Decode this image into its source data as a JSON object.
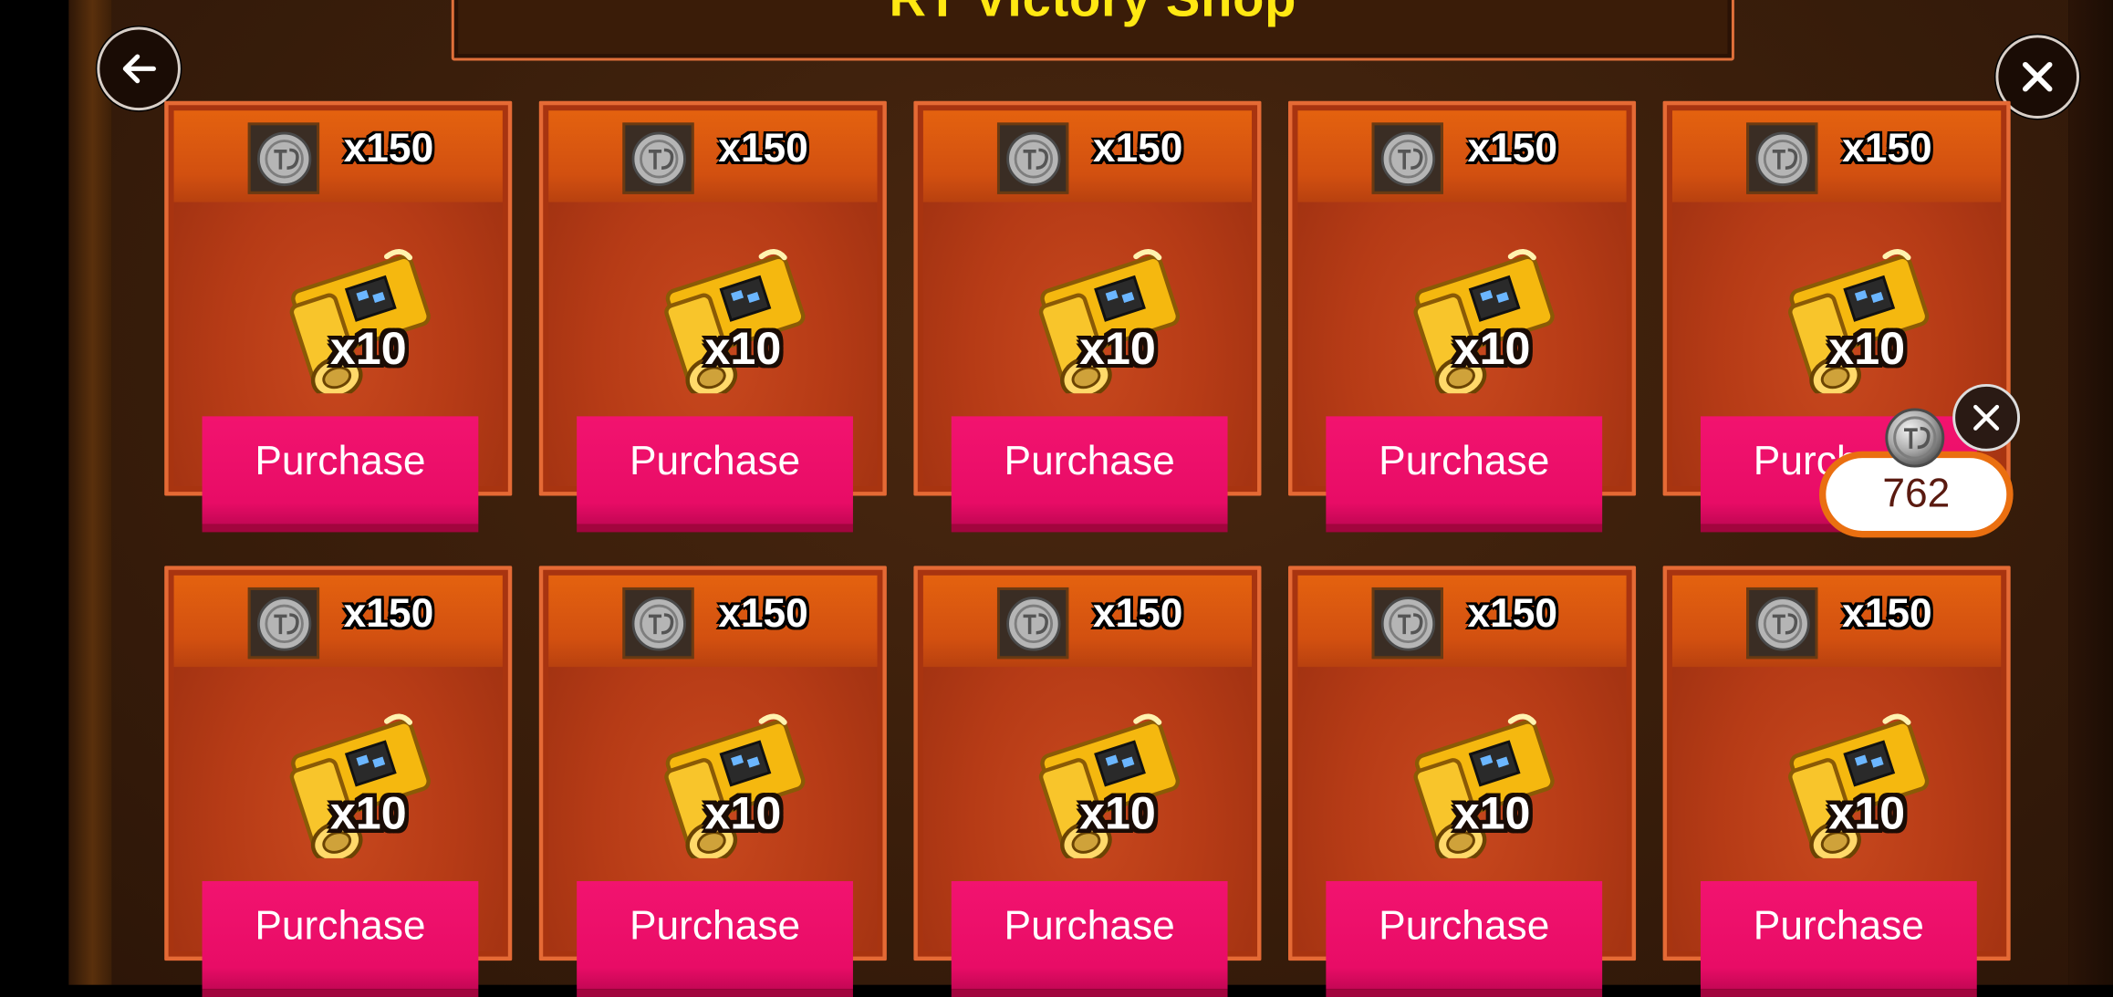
{
  "title": "RT Victory Shop",
  "colors": {
    "purchase_button": "#ec0f6a",
    "card_border": "#e56a35",
    "title": "#ffe812"
  },
  "currency_balance": "762",
  "cards": [
    {
      "price": "x150",
      "quantity": "x10",
      "button": "Purchase"
    },
    {
      "price": "x150",
      "quantity": "x10",
      "button": "Purchase"
    },
    {
      "price": "x150",
      "quantity": "x10",
      "button": "Purchase"
    },
    {
      "price": "x150",
      "quantity": "x10",
      "button": "Purchase"
    },
    {
      "price": "x150",
      "quantity": "x10",
      "button": "Purchase"
    },
    {
      "price": "x150",
      "quantity": "x10",
      "button": "Purchase"
    },
    {
      "price": "x150",
      "quantity": "x10",
      "button": "Purchase"
    },
    {
      "price": "x150",
      "quantity": "x10",
      "button": "Purchase"
    },
    {
      "price": "x150",
      "quantity": "x10",
      "button": "Purchase"
    },
    {
      "price": "x150",
      "quantity": "x10",
      "button": "Purchase"
    }
  ],
  "icons": {
    "back": "arrow-left-icon",
    "close": "close-icon",
    "coin": "coin-icon",
    "item": "golden-scroll-icon"
  }
}
